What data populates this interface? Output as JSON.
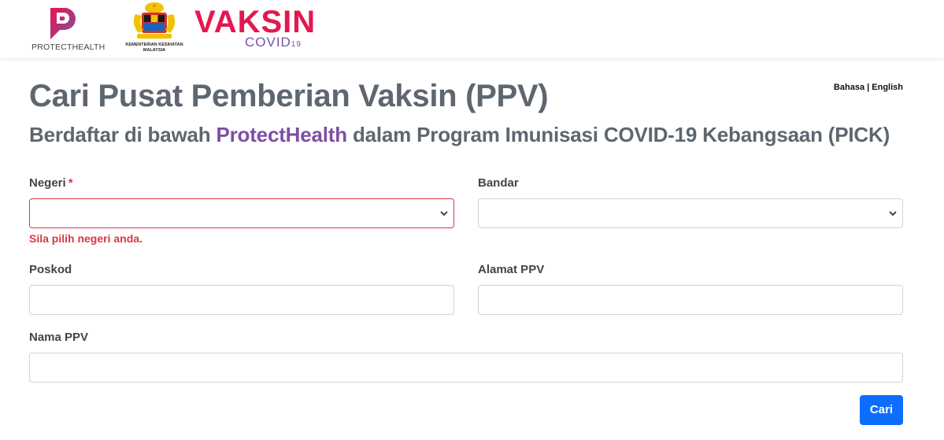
{
  "header": {
    "protecthealth_label": "PROTECTHEALTH",
    "kkm_label_line1": "KEMENTERIAN KESIHATAN",
    "kkm_label_line2": "MALAYSIA",
    "vaksin_word": "VAKSIN",
    "covid_word": "COVID",
    "covid_num": "19"
  },
  "lang": {
    "bahasa": "Bahasa",
    "sep": " | ",
    "english": "English"
  },
  "page": {
    "title": "Cari Pusat Pemberian Vaksin (PPV)",
    "subtitle_pre": "Berdaftar di bawah ",
    "subtitle_brand": "ProtectHealth",
    "subtitle_post": " dalam Program Imunisasi COVID-19 Kebangsaan (PICK)"
  },
  "form": {
    "negeri_label": "Negeri",
    "required_mark": "*",
    "negeri_error": "Sila pilih negeri anda.",
    "bandar_label": "Bandar",
    "poskod_label": "Poskod",
    "alamat_label": "Alamat PPV",
    "nama_label": "Nama PPV",
    "submit_label": "Cari"
  },
  "colors": {
    "brand_purple": "#7e4fa4",
    "brand_pink": "#e5174f",
    "error": "#dc3545",
    "primary": "#0d6efd"
  }
}
